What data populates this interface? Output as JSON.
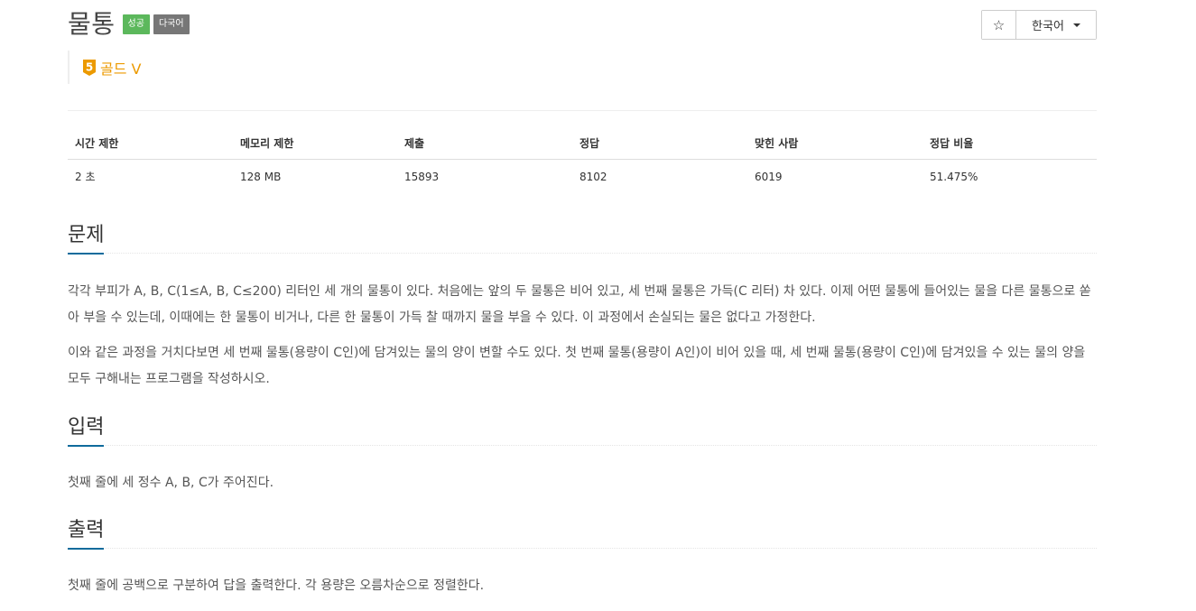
{
  "problem": {
    "title": "물통",
    "badges": {
      "success": "성공",
      "lang": "다국어"
    },
    "tier": {
      "level": "5",
      "name": "골드 V",
      "color": "#ec9a00"
    }
  },
  "toolbar": {
    "star": "☆",
    "language": "한국어"
  },
  "stats": {
    "headers": [
      "시간 제한",
      "메모리 제한",
      "제출",
      "정답",
      "맞힌 사람",
      "정답 비율"
    ],
    "values": [
      "2 초",
      "128 MB",
      "15893",
      "8102",
      "6019",
      "51.475%"
    ]
  },
  "sections": {
    "problem": {
      "heading": "문제",
      "paragraphs": [
        "각각 부피가 A, B, C(1≤A, B, C≤200) 리터인 세 개의 물통이 있다. 처음에는 앞의 두 물통은 비어 있고, 세 번째 물통은 가득(C 리터) 차 있다. 이제 어떤 물통에 들어있는 물을 다른 물통으로 쏟아 부을 수 있는데, 이때에는 한 물통이 비거나, 다른 한 물통이 가득 찰 때까지 물을 부을 수 있다. 이 과정에서 손실되는 물은 없다고 가정한다.",
        "이와 같은 과정을 거치다보면 세 번째 물통(용량이 C인)에 담겨있는 물의 양이 변할 수도 있다. 첫 번째 물통(용량이 A인)이 비어 있을 때, 세 번째 물통(용량이 C인)에 담겨있을 수 있는 물의 양을 모두 구해내는 프로그램을 작성하시오."
      ]
    },
    "input": {
      "heading": "입력",
      "paragraphs": [
        "첫째 줄에 세 정수 A, B, C가 주어진다."
      ]
    },
    "output": {
      "heading": "출력",
      "paragraphs": [
        "첫째 줄에 공백으로 구분하여 답을 출력한다. 각 용량은 오름차순으로 정렬한다."
      ]
    }
  },
  "colors": {
    "accent": "#0f6b9c",
    "success": "#5cb85c",
    "lang_badge": "#777777"
  }
}
